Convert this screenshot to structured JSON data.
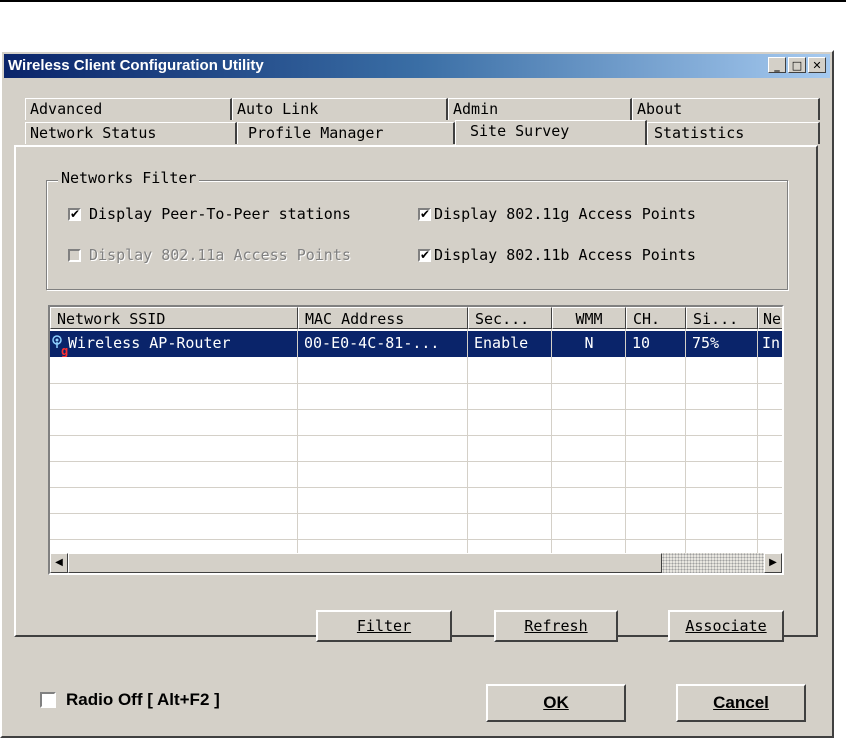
{
  "window": {
    "title": "Wireless Client Configuration Utility",
    "controls": [
      "_",
      "□",
      "✕"
    ]
  },
  "tabs_back": [
    "Advanced",
    "Auto Link",
    "Admin",
    "About"
  ],
  "tabs_front": [
    "Network Status",
    "Profile Manager",
    "Site Survey",
    "Statistics"
  ],
  "active_tab": "Site Survey",
  "filter": {
    "label": "Networks Filter",
    "options": [
      {
        "label": "Display Peer-To-Peer stations",
        "checked": true,
        "enabled": true
      },
      {
        "label": "Display 802.11g Access Points",
        "checked": true,
        "enabled": true
      },
      {
        "label": "Display 802.11a Access Points",
        "checked": false,
        "enabled": false
      },
      {
        "label": "Display 802.11b Access Points",
        "checked": true,
        "enabled": true
      }
    ]
  },
  "table": {
    "columns": [
      "Network SSID",
      "MAC Address",
      "Sec...",
      "WMM",
      "CH.",
      "Si...",
      "Ne"
    ],
    "rows": [
      {
        "ssid_icon_letter": "g",
        "ssid": "Wireless AP-Router",
        "mac": "00-E0-4C-81-...",
        "sec": "Enable",
        "wmm": "N",
        "ch": "10",
        "signal": "75%",
        "ne": "In"
      }
    ]
  },
  "buttons": {
    "filter": "Filter",
    "refresh": "Refresh",
    "associate": "Associate",
    "ok": "OK",
    "cancel": "Cancel"
  },
  "radio_off": {
    "label": "Radio Off  [ Alt+F2 ]",
    "checked": false
  }
}
